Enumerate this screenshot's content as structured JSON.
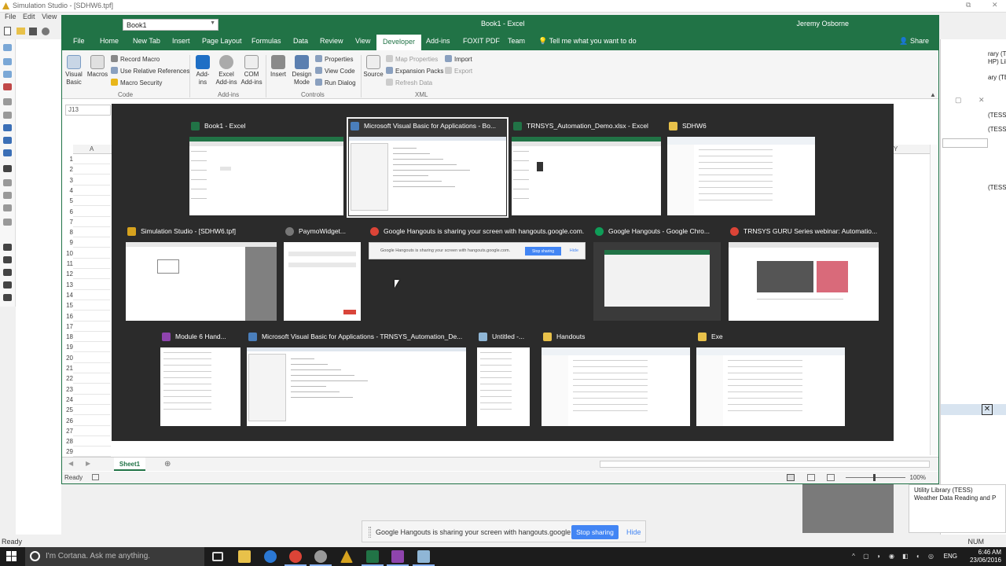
{
  "background_app": {
    "title": "Simulation Studio - [SDHW6.tpf]",
    "menu": [
      "File",
      "Edit",
      "View"
    ],
    "status_left": "Ready",
    "status_right": "NUM",
    "library_items": [
      "Utility Library (TESS)",
      "Weather Data Reading and P"
    ],
    "right_panel_rows": [
      "rary (TESS)",
      "HP) Library (T",
      "ary (TESS)",
      "(TESS)",
      "(TESS)",
      "(TESS)"
    ]
  },
  "excel": {
    "window_title": "Book1 - Excel",
    "name_dropdown": "Book1",
    "user": "Jeremy Osborne",
    "share": "Share",
    "tabs": [
      "File",
      "Home",
      "New Tab",
      "Insert",
      "Page Layout",
      "Formulas",
      "Data",
      "Review",
      "View",
      "Developer",
      "Add-ins",
      "FOXIT PDF",
      "Team"
    ],
    "active_tab": "Developer",
    "tell_me": "Tell me what you want to do",
    "ribbon": {
      "code": {
        "label": "Code",
        "visual_basic": "Visual Basic",
        "macros": "Macros",
        "record_macro": "Record Macro",
        "relative_refs": "Use Relative References",
        "macro_security": "Macro Security"
      },
      "addins": {
        "label": "Add-ins",
        "addins": "Add-ins",
        "excel_addins": "Excel Add-ins",
        "com_addins": "COM Add-ins"
      },
      "controls": {
        "label": "Controls",
        "insert": "Insert",
        "design_mode": "Design Mode",
        "properties": "Properties",
        "view_code": "View Code",
        "run_dialog": "Run Dialog"
      },
      "xml": {
        "label": "XML",
        "source": "Source",
        "map_properties": "Map Properties",
        "expansion_packs": "Expansion Packs",
        "refresh_data": "Refresh Data",
        "import": "Import",
        "export": "Export"
      }
    },
    "name_box": "J13",
    "column_a": "A",
    "column_y": "Y",
    "rows": [
      "1",
      "2",
      "3",
      "4",
      "5",
      "6",
      "7",
      "8",
      "9",
      "10",
      "11",
      "12",
      "13",
      "14",
      "15",
      "16",
      "17",
      "18",
      "19",
      "20",
      "21",
      "22",
      "23",
      "24",
      "25",
      "26",
      "27",
      "28",
      "29"
    ],
    "sheet_tab": "Sheet1",
    "status_ready": "Ready",
    "zoom": "100%"
  },
  "switcher": {
    "windows": [
      {
        "title": "Book1 - Excel",
        "icon": "excel-icon",
        "color": "#217346",
        "selected": false
      },
      {
        "title": "Microsoft Visual Basic for Applications - Bo...",
        "icon": "vba-icon",
        "color": "#4a7ebb",
        "selected": true
      },
      {
        "title": "TRNSYS_Automation_Demo.xlsx - Excel",
        "icon": "excel-icon",
        "color": "#217346",
        "selected": false
      },
      {
        "title": "SDHW6",
        "icon": "folder-icon",
        "color": "#e8c14a",
        "selected": false
      },
      {
        "title": "Simulation Studio - [SDHW6.tpf]",
        "icon": "simulation-studio-icon",
        "color": "#d6a21e",
        "selected": false
      },
      {
        "title": "PaymoWidget...",
        "icon": "paymo-icon",
        "color": "#777777",
        "selected": false
      },
      {
        "title": "Google Hangouts is sharing your screen with hangouts.google.com.",
        "icon": "chrome-icon",
        "color": "#db4437",
        "selected": false
      },
      {
        "title": "Google Hangouts - Google Chro...",
        "icon": "hangouts-icon",
        "color": "#0f9d58",
        "selected": false
      },
      {
        "title": "TRNSYS GURU Series webinar: Automatio...",
        "icon": "chrome-icon",
        "color": "#db4437",
        "selected": false
      },
      {
        "title": "Module 6 Hand...",
        "icon": "module-icon",
        "color": "#8e44ad",
        "selected": false
      },
      {
        "title": "Microsoft Visual Basic for Applications - TRNSYS_Automation_De...",
        "icon": "vba-icon",
        "color": "#4a7ebb",
        "selected": false
      },
      {
        "title": "Untitled -...",
        "icon": "notepad-icon",
        "color": "#8fb6d6",
        "selected": false
      },
      {
        "title": "Handouts",
        "icon": "folder-icon",
        "color": "#e8c14a",
        "selected": false
      },
      {
        "title": "Exe",
        "icon": "folder-icon",
        "color": "#e8c14a",
        "selected": false
      }
    ],
    "hangout_mini_text": "Google Hangouts is sharing your screen with hangouts.google.com.",
    "hangout_mini_stop": "Stop sharing",
    "hangout_mini_hide": "Hide"
  },
  "sharebar": {
    "message": "Google Hangouts is sharing your screen with hangouts.google.com.",
    "stop": "Stop sharing",
    "hide": "Hide"
  },
  "taskbar": {
    "cortana": "I'm Cortana. Ask me anything.",
    "lang": "ENG",
    "time": "6:46 AM",
    "date": "23/06/2016"
  },
  "colors": {
    "excel_green": "#217346",
    "switcher_bg": "#2b2b2b",
    "taskbar_bg": "#1c1c1c",
    "accent_blue": "#4285f4"
  }
}
